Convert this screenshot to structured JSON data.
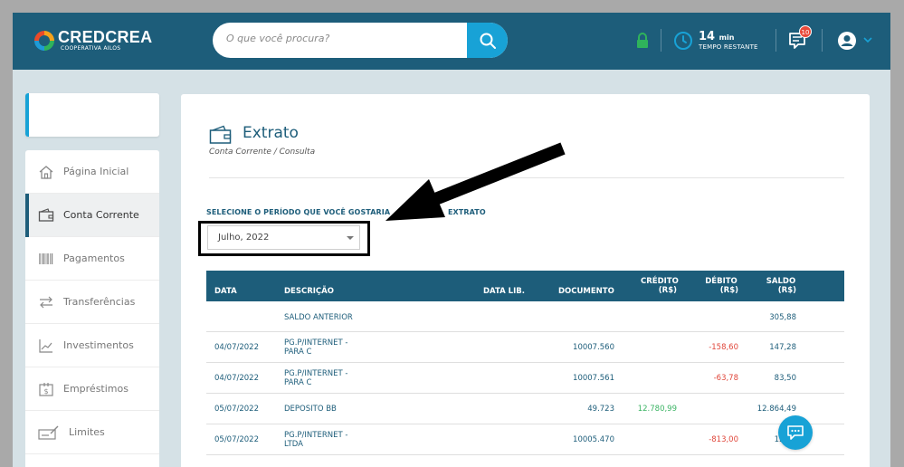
{
  "header": {
    "logo_title": "CREDCREA",
    "logo_subtitle": "COOPERATIVA AILOS",
    "search_placeholder": "O que você procura?",
    "timer_value": "14",
    "timer_unit": "min",
    "timer_label": "TEMPO RESTANTE",
    "notifications_count": "10"
  },
  "sidebar": {
    "items": [
      {
        "label": "Página Inicial",
        "icon": "home-icon"
      },
      {
        "label": "Conta Corrente",
        "icon": "wallet-icon",
        "active": true
      },
      {
        "label": "Pagamentos",
        "icon": "barcode-icon"
      },
      {
        "label": "Transferências",
        "icon": "transfer-icon"
      },
      {
        "label": "Investimentos",
        "icon": "chart-icon"
      },
      {
        "label": "Empréstimos",
        "icon": "loan-icon"
      },
      {
        "label": "Limites",
        "icon": "limit-icon"
      }
    ]
  },
  "page": {
    "title": "Extrato",
    "subtitle": "Conta Corrente / Consulta",
    "period_label": "SELECIONE O PERÍODO QUE VOCÊ GOSTARIA",
    "period_label_end": "EXTRATO",
    "period_value": "Julho, 2022"
  },
  "table": {
    "headers": {
      "data": "DATA",
      "descricao": "DESCRIÇÃO",
      "data_lib": "DATA LIB.",
      "documento": "DOCUMENTO",
      "credito": "CRÉDITO",
      "credito_unit": "(R$)",
      "debito": "DÉBITO",
      "debito_unit": "(R$)",
      "saldo": "SALDO",
      "saldo_unit": "(R$)"
    },
    "rows": [
      {
        "data": "",
        "desc1": "SALDO ANTERIOR",
        "desc2": "",
        "documento": "",
        "credito": "",
        "debito": "",
        "saldo": "305,88"
      },
      {
        "data": "04/07/2022",
        "desc1": "PG.P/INTERNET -",
        "desc2": "PARA C",
        "documento": "10007.560",
        "credito": "",
        "debito": "-158,60",
        "saldo": "147,28"
      },
      {
        "data": "04/07/2022",
        "desc1": "PG.P/INTERNET -",
        "desc2": "PARA C",
        "documento": "10007.561",
        "credito": "",
        "debito": "-63,78",
        "saldo": "83,50"
      },
      {
        "data": "05/07/2022",
        "desc1": "DEPOSITO BB",
        "desc2": "",
        "documento": "49.723",
        "credito": "12.780,99",
        "debito": "",
        "saldo": "12.864,49"
      },
      {
        "data": "05/07/2022",
        "desc1": "PG.P/INTERNET -",
        "desc2": "LTDA",
        "documento": "10005.470",
        "credito": "",
        "debito": "-813,00",
        "saldo": "12.05"
      }
    ]
  },
  "colors": {
    "primary": "#1d5d7a",
    "accent": "#18a2d6",
    "debit": "#e0463a",
    "credit": "#3bb464"
  }
}
